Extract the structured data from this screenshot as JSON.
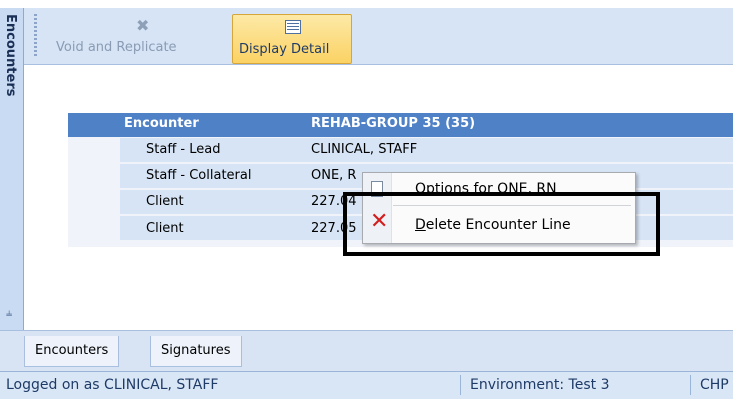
{
  "sidebar": {
    "title": "Encounters",
    "pin_icon": "pin-icon"
  },
  "toolbar": {
    "void_label": "Void and Replicate",
    "void_icon": "void-icon",
    "detail_label": "Display Detail",
    "detail_icon": "display-detail-icon"
  },
  "grid": {
    "header": {
      "label": "Encounter",
      "value": "REHAB-GROUP 35 (35)"
    },
    "rows": [
      {
        "label": "Staff - Lead",
        "value": "CLINICAL, STAFF"
      },
      {
        "label": "Staff - Collateral",
        "value": "ONE, R"
      },
      {
        "label": "Client",
        "value": "227.04"
      },
      {
        "label": "Client",
        "value": "227.05"
      }
    ]
  },
  "context_menu": {
    "items": [
      {
        "label": "Options for ONE, RN",
        "icon": "document-icon"
      },
      {
        "label_underline": "D",
        "label_rest": "elete Encounter Line",
        "icon": "delete-x-icon"
      }
    ]
  },
  "tabs": [
    "Encounters",
    "Signatures"
  ],
  "status": {
    "logged_on": "Logged on as CLINICAL, STAFF",
    "environment": "Environment: Test 3",
    "code": "CHP"
  },
  "colors": {
    "grid_header": "#4f81c7",
    "selected_button": "#fbd264",
    "delete_icon": "#d21e1e",
    "highlight_box": "#000000"
  }
}
